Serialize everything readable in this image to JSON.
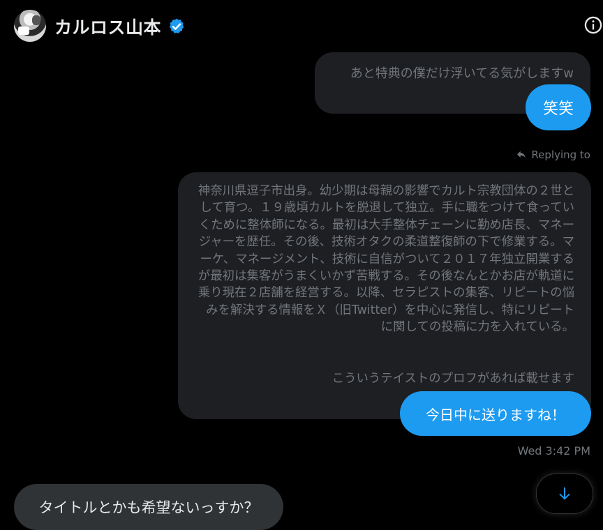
{
  "header": {
    "name": "カルロス山本",
    "verified_icon": "verified-badge-icon",
    "info_icon": "info-icon"
  },
  "colors": {
    "background": "#000000",
    "accent": "#1d9bf0",
    "bubble_gray": "#1e1f23",
    "bubble_incoming": "#2f3336",
    "muted_text": "#71767b"
  },
  "messages": {
    "quoted_top": "あと特典の僕だけ浮いてる気がしますw",
    "laugh": "笑笑",
    "replying_label": "Replying to",
    "profile_body": "神奈川県逗子市出身。幼少期は母親の影響でカルト宗教団体の２世として育つ。１９歳頃カルトを脱退して独立。手に職をつけて食っていくために整体師になる。最初は大手整体チェーンに勤め店長、マネージャーを歴任。その後、技術オタクの柔道整復師の下で修業する。マーケ、マネージメント、技術に自信がついて２０１７年独立開業するが最初は集客がうまくいかず苦戦する。その後なんとかお店が軌道に乗り現在２店舗を経営する。以降、セラピストの集客、リピートの悩みを解決する情報をＸ（旧Twitter）を中心に発信し、特にリピートに関しての投稿に力を入れている。",
    "profile_ask": "こういうテイストのプロフがあれば載せます",
    "reply_today": "今日中に送りますね！",
    "timestamp": "Wed 3:42 PM",
    "incoming": "タイトルとかも希望ないっすか？"
  },
  "scroll_button": {
    "icon": "arrow-down-icon"
  }
}
